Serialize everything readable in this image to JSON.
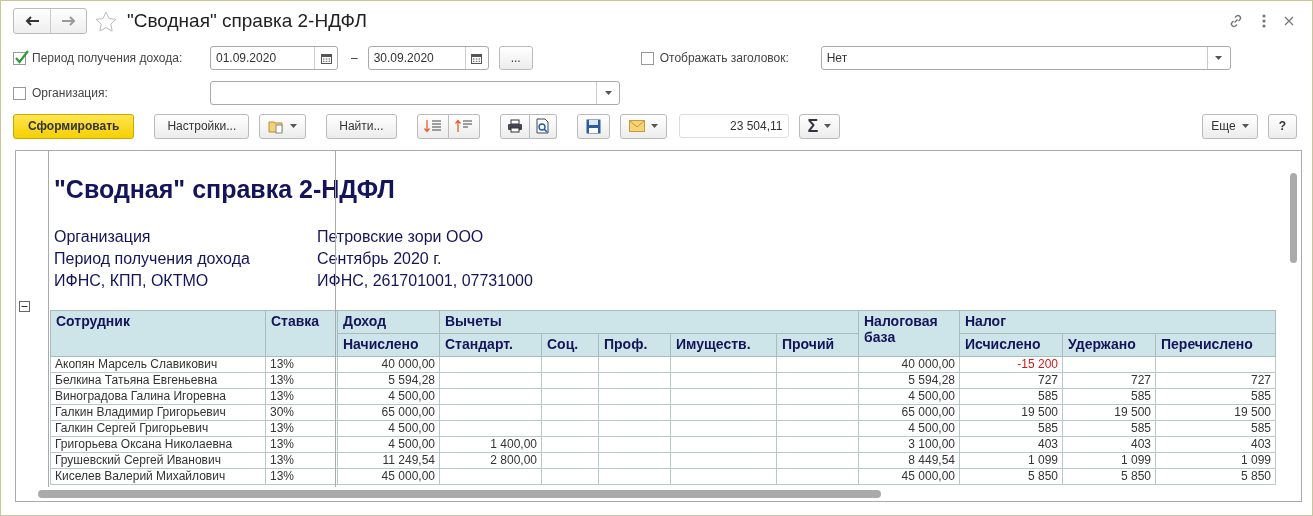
{
  "window": {
    "title": "\"Сводная\" справка 2-НДФЛ",
    "favorite": false
  },
  "period": {
    "checked": true,
    "label": "Период получения дохода:",
    "from": "01.09.2020",
    "separator": "–",
    "to": "30.09.2020",
    "more_button": "..."
  },
  "show_header": {
    "checked": false,
    "label": "Отображать заголовок:",
    "value": "Нет"
  },
  "organization": {
    "checked": false,
    "label": "Организация:"
  },
  "toolbar": {
    "generate": "Сформировать",
    "settings": "Настройки...",
    "find": "Найти...",
    "sum": "23 504,11",
    "sum_symbol": "Σ",
    "more": "Еще",
    "help": "?"
  },
  "report": {
    "title": "\"Сводная\" справка 2-НДФЛ",
    "info": [
      {
        "label": "Организация",
        "value": "Петровские зори ООО"
      },
      {
        "label": "Период получения дохода",
        "value": "Сентябрь 2020 г."
      },
      {
        "label": "ИФНС, КПП, ОКТМО",
        "value": "ИФНС, 261701001, 07731000"
      }
    ],
    "header": {
      "employee": "Сотрудник",
      "rate": "Ставка",
      "income": "Доход",
      "accrued": "Начислено",
      "deductions": "Вычеты",
      "standard": "Стандарт.",
      "social": "Соц.",
      "professional": "Проф.",
      "property": "Имуществ.",
      "other": "Прочий",
      "tax_base": "Налоговая база",
      "tax": "Налог",
      "calculated": "Исчислено",
      "withheld": "Удержано",
      "transferred": "Перечислено"
    },
    "rows": [
      {
        "name": "Акопян Марсель Славикович",
        "rate": "13%",
        "accrued": "40 000,00",
        "standard": "",
        "base": "40 000,00",
        "calculated": "-15 200",
        "withheld": "",
        "transferred": "",
        "calculated_negative": true
      },
      {
        "name": "Белкина Татьяна Евгеньевна",
        "rate": "13%",
        "accrued": "5 594,28",
        "standard": "",
        "base": "5 594,28",
        "calculated": "727",
        "withheld": "727",
        "transferred": "727",
        "calculated_negative": false
      },
      {
        "name": "Виноградова Галина Игоревна",
        "rate": "13%",
        "accrued": "4 500,00",
        "standard": "",
        "base": "4 500,00",
        "calculated": "585",
        "withheld": "585",
        "transferred": "585",
        "calculated_negative": false
      },
      {
        "name": "Галкин Владимир Григорьевич",
        "rate": "30%",
        "accrued": "65 000,00",
        "standard": "",
        "base": "65 000,00",
        "calculated": "19 500",
        "withheld": "19 500",
        "transferred": "19 500",
        "calculated_negative": false
      },
      {
        "name": "Галкин Сергей Григорьевич",
        "rate": "13%",
        "accrued": "4 500,00",
        "standard": "",
        "base": "4 500,00",
        "calculated": "585",
        "withheld": "585",
        "transferred": "585",
        "calculated_negative": false
      },
      {
        "name": "Григорьева Оксана Николаевна",
        "rate": "13%",
        "accrued": "4 500,00",
        "standard": "1 400,00",
        "base": "3 100,00",
        "calculated": "403",
        "withheld": "403",
        "transferred": "403",
        "calculated_negative": false
      },
      {
        "name": "Грушевский Сергей Иванович",
        "rate": "13%",
        "accrued": "11 249,54",
        "standard": "2 800,00",
        "base": "8 449,54",
        "calculated": "1 099",
        "withheld": "1 099",
        "transferred": "1 099",
        "calculated_negative": false
      },
      {
        "name": "Киселев Валерий Михайлович",
        "rate": "13%",
        "accrued": "45 000,00",
        "standard": "",
        "base": "45 000,00",
        "calculated": "5 850",
        "withheld": "5 850",
        "transferred": "5 850",
        "calculated_negative": false
      }
    ]
  }
}
